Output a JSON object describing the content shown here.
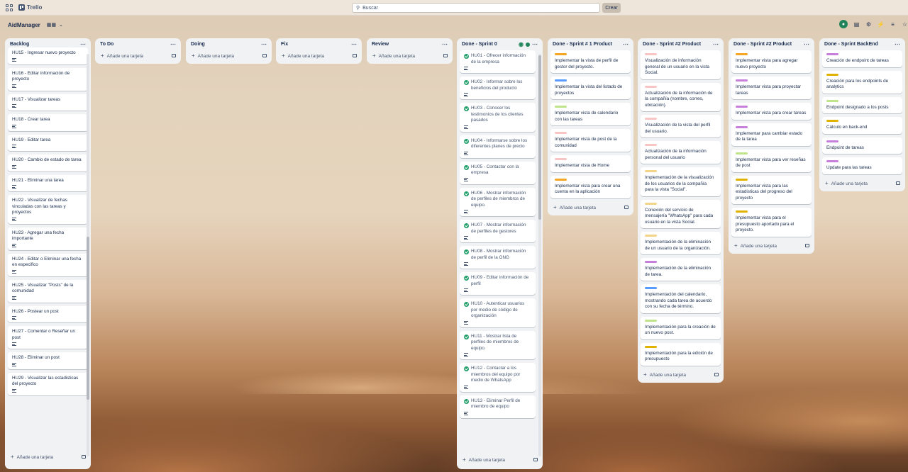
{
  "app": {
    "name": "Trello"
  },
  "search": {
    "placeholder": "Buscar"
  },
  "create_label": "Crear",
  "board": {
    "title": "AidManager"
  },
  "add_card_label": "Añade una tarjeta",
  "label_colors": {
    "orange": "#f5a623",
    "blue": "#579dff",
    "green": "#baf3a5",
    "pink": "#f8c5c5",
    "purple": "#c77fdc",
    "yellow": "#e2b203",
    "lime": "#c0e48a"
  },
  "lists": {
    "backlog": {
      "title": "Backlog",
      "cards": [
        "HU15 - Ingresar nuevo proyecto",
        "HU16 - Editar información de proyecto",
        "HU17 - Visualizar tareas",
        "HU18 - Crear tarea",
        "HU19 - Editar tarea",
        "HU20 - Cambio de estado de tarea",
        "HU21 - Eliminar una tarea",
        "HU22 - Visualizar de fechas vinculadas con las tareas y proyectos",
        "HU23 - Agregar una fecha importante",
        "HU24 - Editar o Eliminar una fecha en especifico",
        "HU25 - Visualizar \"Posts\" de la comunidad",
        "HU26 - Postear un post",
        "HU27 - Comentar o Reseñar un post",
        "HU28 - Eliminar un post",
        "HU29 - Visualizar las estadisticas del proyecto"
      ]
    },
    "todo": {
      "title": "To Do"
    },
    "doing": {
      "title": "Doing"
    },
    "fix": {
      "title": "Fix"
    },
    "review": {
      "title": "Review"
    },
    "sprint0": {
      "title": "Done - Sprint 0",
      "cards": [
        "HU01 - Ofrecer información de la empresa",
        "HU02 - Informar sobre los beneficios del producto",
        "HU03 - Conocer los testimonios de los clientes pasados",
        "HU04 - Informarse sobre los diferentes planes de precio",
        "HU05 - Contactar con la empresa",
        "HU06 - Mostrar información de perfiles de miembros de equipo.",
        "HU07 - Mostrar información de perfiles de gestores",
        "HU08 - Mostrar información de perfil de la ONG",
        "HU09 - Editar información de perfil",
        "HU10 - Autenticar usuarios por medio de código de organización",
        "HU11 - Mostrar lista de perfiles de miembros de equipo.",
        "HU12 - Contactar a los miembros del equipo por medio de WhatsApp",
        "HU13 - Eliminar Perfil de miembro de equipo"
      ]
    },
    "sprint1": {
      "title": "Done - Sprint # 1 Product",
      "cards": [
        "Implementar la vista de perfil de gestor del proyecto.",
        "Implementar la vista del listado de proyectos",
        "Implementar vista de calendario con las tareas",
        "Implementar vista de post de la comunidad",
        "Implementar vista de Home",
        "Implementar vista para crear una cuenta en la aplicación"
      ]
    },
    "sprint2": {
      "title": "Done - Sprint #2 Product",
      "cards": [
        "Visualización de información general de un usuario en la vista Social.",
        "Actualización de la información de la compañía (nombre, correo, ubicación).",
        "Visualización de la vista del perfil del usuario.",
        "Actualización de la información personal del usuario",
        "Implementación de la visualización de los usuarios de la compañía para la vista \"Social\".",
        "Conexión del servicio de mensajería \"WhatsApp\" para cada usuario en la vista Social.",
        "Implementación de la eliminación de un usuario de la organización.",
        "Implementación de la eliminación de tarea.",
        "Implementación del calendario, mostrando cada tarea de acuerdo con su fecha de término.",
        "Implementación para la creación de un nuevo post.",
        "Implementación para la edición de presupuesto"
      ]
    },
    "sprint2b": {
      "title": "Done - Sprint #2 Product",
      "cards": [
        "Implementar vista para agregar nuevo proyecto",
        "Implementar vista para proyectar tareas",
        "Implementar vista para crear tareas",
        "Implementar para cambiar estado de la tarea",
        "Implementar vista para ver reseñas de post",
        "Implementar vista para las estadisticas del progreso del proyecto",
        "Implementar vista para el presupuesto aportado para el proyecto."
      ]
    },
    "backend": {
      "title": "Done - Sprint BackEnd",
      "cards": [
        "Creación de endpoint de tareas",
        "Creación para los endpoints de analytics",
        "Endpoint designado a los posts",
        "Cálculo en back-end",
        "Endpoint de tareas",
        "Update para las tareas"
      ]
    }
  }
}
